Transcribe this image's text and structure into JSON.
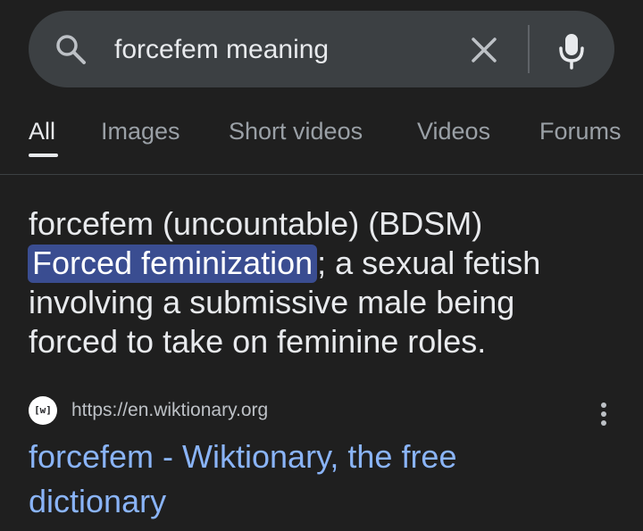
{
  "search": {
    "query": "forcefem meaning"
  },
  "tabs": [
    {
      "label": "All",
      "active": true
    },
    {
      "label": "Images",
      "active": false
    },
    {
      "label": "Short videos",
      "active": false
    },
    {
      "label": "Videos",
      "active": false
    },
    {
      "label": "Forums",
      "active": false
    }
  ],
  "definition": {
    "line1": "forcefem (uncountable) (BDSM)",
    "highlight": "Forced feminization",
    "line2_rest": "; a sexual fetish",
    "line3": "involving a submissive male being",
    "line4": "forced to take on feminine roles."
  },
  "result": {
    "favicon_text": "[w]",
    "url": "https://en.wiktionary.org",
    "title_line1": "forcefem - Wiktionary, the free",
    "title_line2": "dictionary"
  },
  "colors": {
    "background": "#1f1f1f",
    "search_bar": "#3c4043",
    "highlight": "#3a4d91",
    "link": "#8ab4f8"
  },
  "icons": {
    "search": "search-icon",
    "clear": "close-icon",
    "mic": "microphone-icon",
    "more": "more-vert-icon"
  }
}
